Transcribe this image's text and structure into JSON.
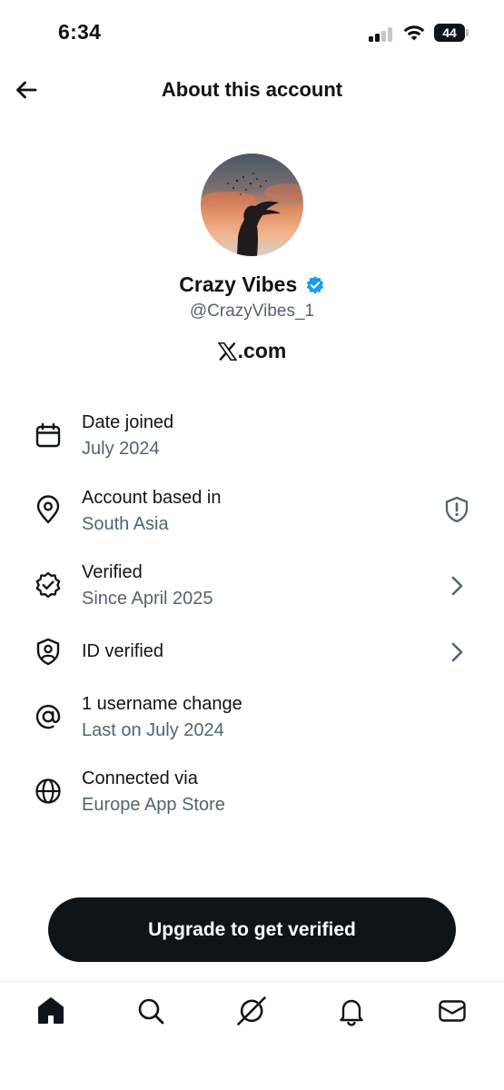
{
  "status_bar": {
    "time": "6:34",
    "battery_level": "44"
  },
  "header": {
    "title": "About this account",
    "back_icon": "arrow-left-icon"
  },
  "profile": {
    "name": "Crazy Vibes",
    "handle": "@CrazyVibes_1",
    "verified_badge_color": "#1d9bf0",
    "domain": ".com",
    "domain_logo": "x-logo"
  },
  "info": [
    {
      "icon": "calendar-icon",
      "title": "Date joined",
      "subtitle": "July 2024"
    },
    {
      "icon": "location-pin-icon",
      "title": "Account based in",
      "subtitle": "South Asia",
      "right_icon": "shield-alert-icon"
    },
    {
      "icon": "verified-check-icon",
      "title": "Verified",
      "subtitle": "Since April 2025",
      "right_icon": "chevron-right-icon"
    },
    {
      "icon": "id-shield-icon",
      "title": "ID verified",
      "right_icon": "chevron-right-icon"
    },
    {
      "icon": "at-sign-icon",
      "title": "1 username change",
      "subtitle": "Last on July 2024"
    },
    {
      "icon": "globe-icon",
      "title": "Connected via",
      "subtitle": "Europe App Store"
    }
  ],
  "cta": {
    "label": "Upgrade to get verified"
  },
  "bottom_nav": [
    {
      "icon": "home-icon",
      "active": true
    },
    {
      "icon": "search-icon"
    },
    {
      "icon": "grok-icon"
    },
    {
      "icon": "bell-icon"
    },
    {
      "icon": "mail-icon"
    }
  ],
  "colors": {
    "text": "#0f1419",
    "secondary": "#536471",
    "accent": "#1d9bf0",
    "button": "#0f1419"
  }
}
